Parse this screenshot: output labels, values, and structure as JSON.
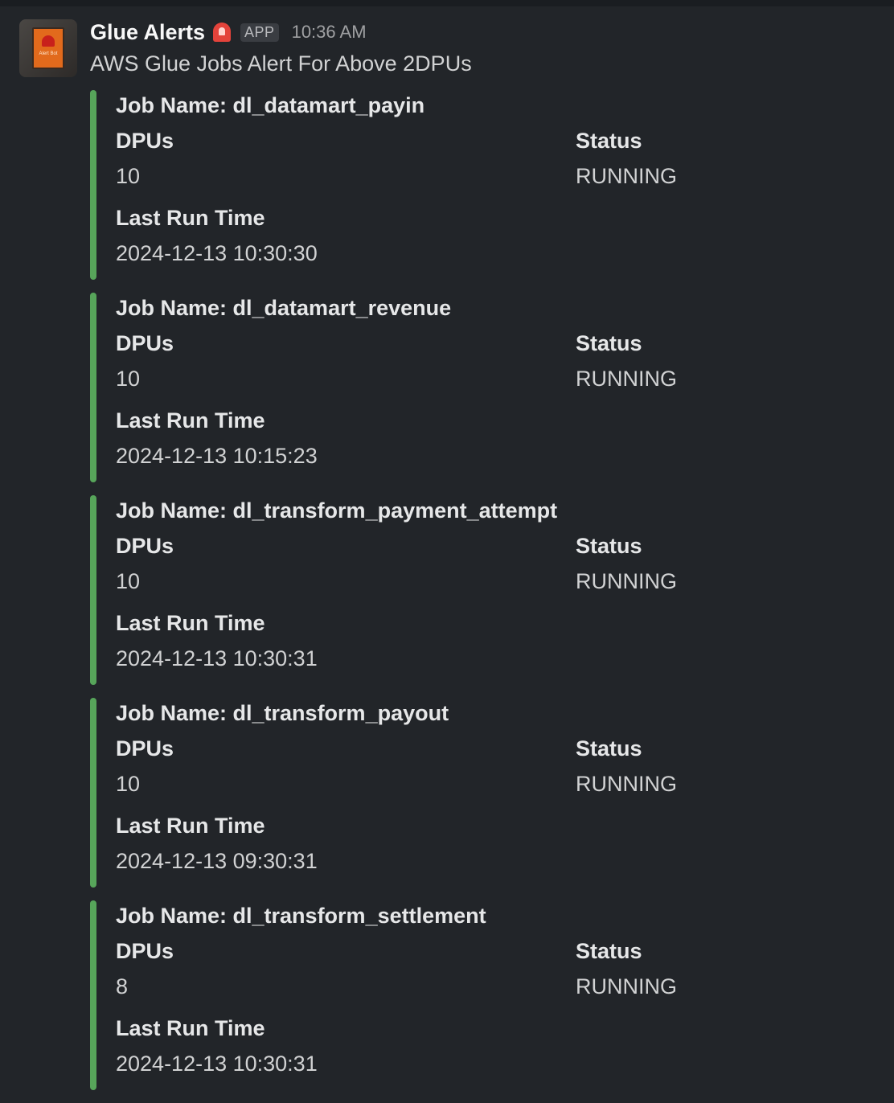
{
  "message": {
    "sender": "Glue Alerts",
    "badge": "APP",
    "time": "10:36 AM",
    "avatar_text": "Alert Bot",
    "text": "AWS Glue Jobs Alert For Above 2DPUs"
  },
  "colors": {
    "attachment_bar": "#57a55a",
    "background": "#222529"
  },
  "field_labels": {
    "dpus": "DPUs",
    "status": "Status",
    "last_run_time": "Last Run Time"
  },
  "attachments": [
    {
      "job_name": "Job Name: dl_datamart_payin",
      "dpus": "10",
      "status": "RUNNING",
      "last_run_time": "2024-12-13 10:30:30"
    },
    {
      "job_name": "Job Name: dl_datamart_revenue",
      "dpus": "10",
      "status": "RUNNING",
      "last_run_time": "2024-12-13 10:15:23"
    },
    {
      "job_name": "Job Name: dl_transform_payment_attempt",
      "dpus": "10",
      "status": "RUNNING",
      "last_run_time": "2024-12-13 10:30:31"
    },
    {
      "job_name": "Job Name: dl_transform_payout",
      "dpus": "10",
      "status": "RUNNING",
      "last_run_time": "2024-12-13 09:30:31"
    },
    {
      "job_name": "Job Name: dl_transform_settlement",
      "dpus": "8",
      "status": "RUNNING",
      "last_run_time": "2024-12-13 10:30:31"
    }
  ]
}
